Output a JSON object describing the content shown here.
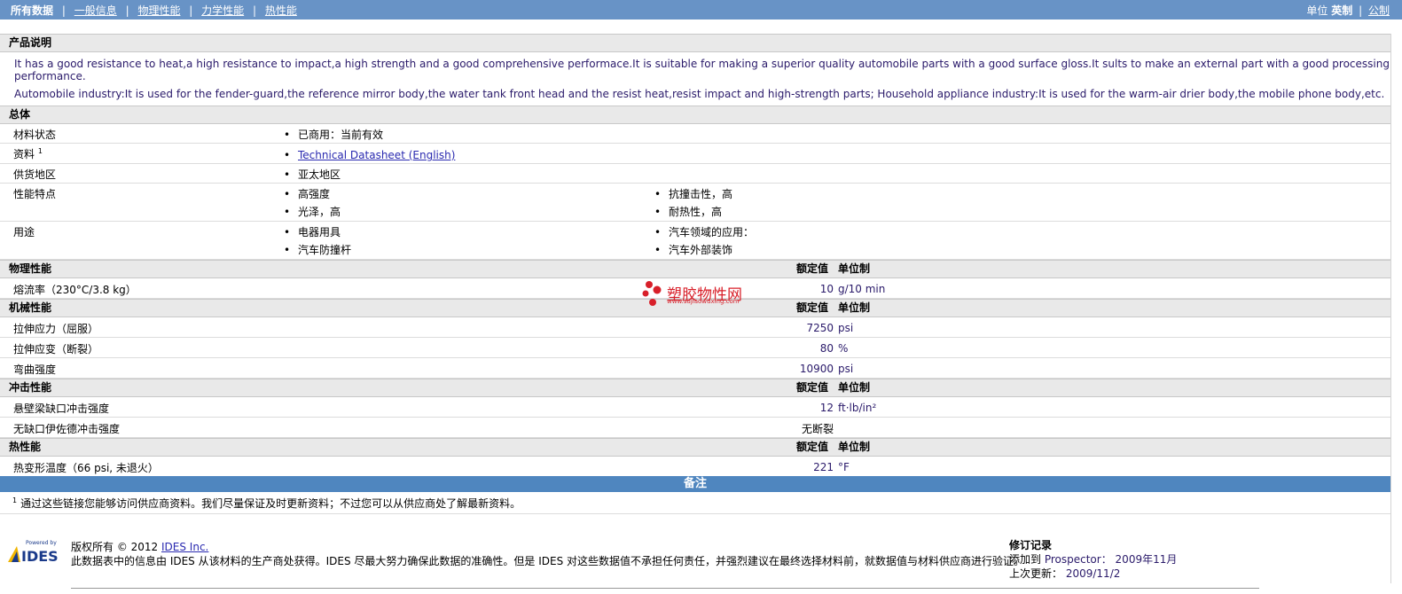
{
  "nav": {
    "current": "所有数据",
    "links": [
      "一般信息",
      "物理性能",
      "力学性能",
      "热性能"
    ]
  },
  "units": {
    "label": "单位",
    "current": "英制",
    "other": "公制"
  },
  "description": {
    "title": "产品说明",
    "p1": "It has a good resistance to heat,a high resistance to impact,a high strength and a good comprehensive performace.It is suitable for making a superior quality automobile parts with a good surface gloss.It sults to make an external part with a good processing performance.",
    "p2": "Automobile industry:It is used for the fender-guard,the reference mirror body,the water tank front head and the resist heat,resist impact and high-strength parts; Household appliance industry:It is used for the warm-air drier body,the mobile phone body,etc."
  },
  "general": {
    "title": "总体",
    "status_label": "材料状态",
    "status_value": "已商用：当前有效",
    "docs_label": "资料",
    "docs_sup": "1",
    "docs_link": "Technical Datasheet (English)",
    "region_label": "供货地区",
    "region_value": "亚太地区",
    "features_label": "性能特点",
    "features": [
      "高强度",
      "抗撞击性，高",
      "光泽，高",
      "耐热性，高"
    ],
    "uses_label": "用途",
    "uses": [
      "电器用具",
      "汽车领域的应用：",
      "汽车防撞杆",
      "汽车外部装饰"
    ]
  },
  "headers": {
    "value": "额定值",
    "unit": "单位制"
  },
  "physical": {
    "title": "物理性能",
    "rows": [
      {
        "label": "熔流率（230°C/3.8 kg）",
        "value": "10",
        "unit": "g/10 min"
      }
    ]
  },
  "mechanical": {
    "title": "机械性能",
    "rows": [
      {
        "label": "拉伸应力（屈服）",
        "value": "7250",
        "unit": "psi"
      },
      {
        "label": "拉伸应变（断裂）",
        "value": "80",
        "unit": "%"
      },
      {
        "label": "弯曲强度",
        "value": "10900",
        "unit": "psi"
      }
    ]
  },
  "impact": {
    "title": "冲击性能",
    "rows": [
      {
        "label": "悬壁梁缺口冲击强度",
        "value": "12",
        "unit": "ft·lb/in²"
      },
      {
        "label": "无缺口伊佐德冲击强度",
        "value": "无断裂",
        "unit": ""
      }
    ]
  },
  "thermal": {
    "title": "热性能",
    "rows": [
      {
        "label": "热变形温度（66 psi, 未退火）",
        "value": "221",
        "unit": "°F"
      }
    ]
  },
  "notes": {
    "title": "备注",
    "sup": "1",
    "text": "通过这些链接您能够访问供应商资料。我们尽量保证及时更新资料；不过您可以从供应商处了解最新资料。"
  },
  "watermark": {
    "title": "塑胶物性网",
    "url": "www.sujiaowuxing.com"
  },
  "footer": {
    "logo_top": "Powered by",
    "logo_text": "IDES",
    "copyright_prefix": "版权所有 © 2012",
    "copyright_link": "IDES Inc.",
    "disclaimer": "此数据表中的信息由 IDES 从该材料的生产商处获得。IDES 尽最大努力确保此数据的准确性。但是 IDES 对这些数据值不承担任何责任，并强烈建议在最终选择材料前，就数据值与材料供应商进行验证。",
    "rev_title": "修订记录",
    "added_label": "添加到",
    "added_where": "Prospector：",
    "added_date": "2009年11月",
    "updated_label": "上次更新：",
    "updated_date": "2009/11/2"
  },
  "colors": {
    "topbar": "#6893c6",
    "notes_bar": "#4f86bf",
    "section_bg": "#e9e9e9",
    "watermark": "#d8202a"
  }
}
